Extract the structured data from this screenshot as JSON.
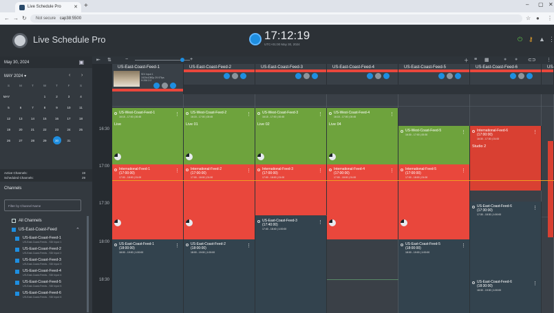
{
  "browser": {
    "tab_title": "Live Schedule Pro",
    "security_label": "Not secure",
    "url": "cap38:5500"
  },
  "app": {
    "title": "Live Schedule Pro",
    "clock": "17:12:19",
    "clock_sub": "UTC+01:00   May 30, 2024"
  },
  "sidebar": {
    "date_header": "May 30, 2024",
    "month_label": "MAY 2024 ▾",
    "dow": [
      "S",
      "M",
      "T",
      "W",
      "T",
      "F",
      "S"
    ],
    "month_short": "MAY",
    "weeks": [
      [
        "",
        "",
        "",
        "1",
        "2",
        "3",
        "4"
      ],
      [
        "5",
        "6",
        "7",
        "8",
        "9",
        "10",
        "11"
      ],
      [
        "12",
        "13",
        "14",
        "15",
        "16",
        "17",
        "18"
      ],
      [
        "19",
        "20",
        "21",
        "22",
        "23",
        "24",
        "25"
      ],
      [
        "26",
        "27",
        "28",
        "29",
        "30",
        "31",
        ""
      ]
    ],
    "selected_day": "30",
    "active_channels_label": "Active Channels:",
    "active_channels": "19",
    "scheduled_channels_label": "Scheduled Channels:",
    "scheduled_channels": "29",
    "channels_title": "Channels",
    "filter_placeholder": "Filter by Channel Name",
    "all_channels": "All Channels",
    "group": "US-East-Coast-Feed",
    "feeds": [
      {
        "name": "US-East-Coast-Feed-1",
        "sub": "US-East-Coast-Feeds - SDI Input 1"
      },
      {
        "name": "US-East-Coast-Feed-2",
        "sub": "US-East-Coast-Feeds - SDI Input 2"
      },
      {
        "name": "US-East-Coast-Feed-3",
        "sub": "US-East-Coast-Feeds - SDI Input 3"
      },
      {
        "name": "US-East-Coast-Feed-4",
        "sub": "US-East-Coast-Feeds - SDI Input 4"
      },
      {
        "name": "US-East-Coast-Feed-5",
        "sub": "US-East-Coast-Feeds - SDI Input 5"
      },
      {
        "name": "US-East-Coast-Feed-6",
        "sub": "US-East-Coast-Feeds - SDI Input 6"
      }
    ]
  },
  "times": [
    "16:30",
    "17:00",
    "17:30",
    "18:00",
    "18:30"
  ],
  "channels": [
    {
      "name": "US-East-Coast-Feed-1",
      "thumb_info": [
        "SDI Input 1",
        "1920x1080p 29.97fps",
        "H.264 2:2"
      ]
    },
    {
      "name": "US-East-Coast-Feed-2"
    },
    {
      "name": "US-East-Coast-Feed-3"
    },
    {
      "name": "US-East-Coast-Feed-4"
    },
    {
      "name": "US-East-Coast-Feed-5"
    },
    {
      "name": "US-East-Coast-Feed-6"
    },
    {
      "name": "US-"
    }
  ],
  "events": {
    "west": [
      {
        "title": "US-West-Coast-Feed-1",
        "sub": "16:15 - 17:00  |  00:45",
        "loc": "Live"
      },
      {
        "title": "US-West-Coast-Feed-2",
        "sub": "16:15 - 17:00  |  00:45",
        "loc": "Live 01"
      },
      {
        "title": "US-West-Coast-Feed-3",
        "sub": "16:15 - 17:00  |  00:45",
        "loc": "Live 02"
      },
      {
        "title": "US-West-Coast-Feed-4",
        "sub": "16:15 - 17:00  |  00:45",
        "loc": "Live 04"
      },
      {
        "title": "US-West-Coast-Feed-5",
        "sub": "16:30 - 17:00  |  00:30"
      }
    ],
    "intl": [
      {
        "title": "International-Feed-1",
        "time": "(17:00:00)",
        "sub": "17:00 - 18:00  |  01:00"
      },
      {
        "title": "International-Feed-2",
        "time": "(17:00:00)",
        "sub": "17:00 - 18:00  |  01:00"
      },
      {
        "title": "International-Feed-3",
        "time": "(17:00:00)",
        "sub": "17:00 - 18:00  |  01:00"
      },
      {
        "title": "International-Feed-4",
        "time": "(17:00:00)",
        "sub": "17:00 - 18:00  |  01:00"
      },
      {
        "title": "International-Feed-5",
        "time": "(17:00:00)",
        "sub": "17:00 - 18:00  |  01:00"
      },
      {
        "title": "International-Feed-6",
        "time": "(17:00:00)",
        "sub": "16:30 - 17:30  |  01:00",
        "loc": "Studio 2"
      }
    ],
    "east": [
      {
        "title": "US-East-Coast-Feed-1",
        "time": "(18:00:00)",
        "sub": "18:00 - 19:00  |  1:00:00"
      },
      {
        "title": "US-East-Coast-Feed-2",
        "time": "(18:00:00)",
        "sub": "18:00 - 19:00  |  1:00:00"
      },
      {
        "title": "US-East-Coast-Feed-3",
        "time": "(17:40:00)",
        "sub": "17:40 - 18:40  |  1:00:00"
      },
      {
        "title": "US-East-Coast-Feed-5",
        "time": "(18:00:00)",
        "sub": "18:00 - 19:00  |  1:00:00"
      },
      {
        "title": "US-East-Coast-Feed-6",
        "time": "(17:30:00)",
        "sub": "17:30 - 18:30  |  1:00:00"
      },
      {
        "title": "US-East-Coast-Feed-6",
        "time": "(18:30:00)",
        "sub": "18:30 - 19:30  |  1:00:00"
      }
    ]
  }
}
